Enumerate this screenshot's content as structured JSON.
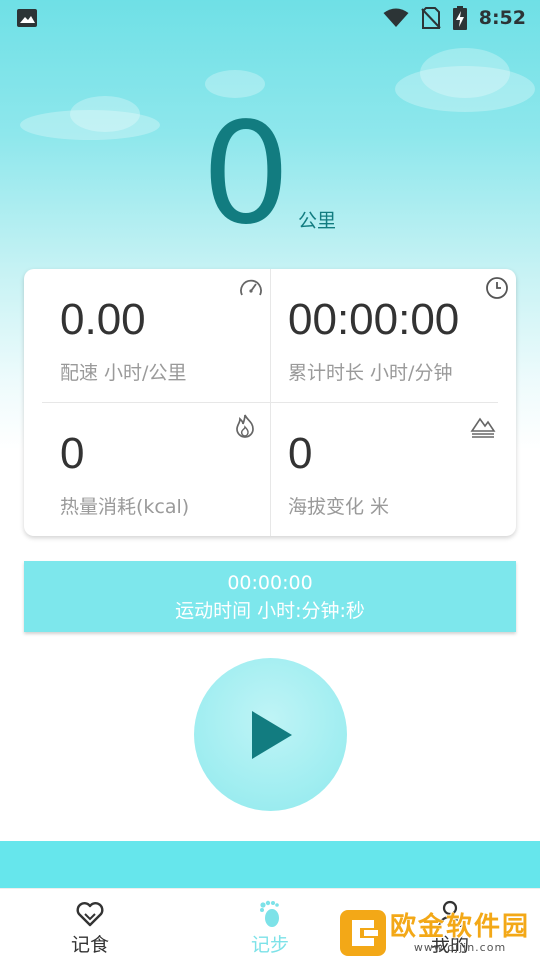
{
  "status_bar": {
    "time": "8:52"
  },
  "distance": {
    "value": "0",
    "unit": "公里"
  },
  "stats": [
    {
      "value": "0.00",
      "label": "配速  小时/公里",
      "icon": "speedometer-icon"
    },
    {
      "value": "00:00:00",
      "label": "累计时长  小时/分钟",
      "icon": "clock-icon"
    },
    {
      "value": "0",
      "label": "热量消耗(kcal)",
      "icon": "flame-icon"
    },
    {
      "value": "0",
      "label": "海拔变化 米",
      "icon": "mountain-icon"
    }
  ],
  "timer": {
    "value": "00:00:00",
    "label": "运动时间 小时:分钟:秒"
  },
  "tabs": [
    {
      "label": "记食",
      "icon": "heart-icon"
    },
    {
      "label": "记步",
      "icon": "footprint-icon"
    },
    {
      "label": "我的",
      "icon": "person-icon"
    }
  ],
  "watermark": {
    "title": "欧金软件园",
    "url": "www.ojjin.com"
  },
  "colors": {
    "accent": "#7de7ec",
    "distance": "#127c80",
    "play_icon": "#127c80",
    "active_tab": "#7de2e8"
  }
}
